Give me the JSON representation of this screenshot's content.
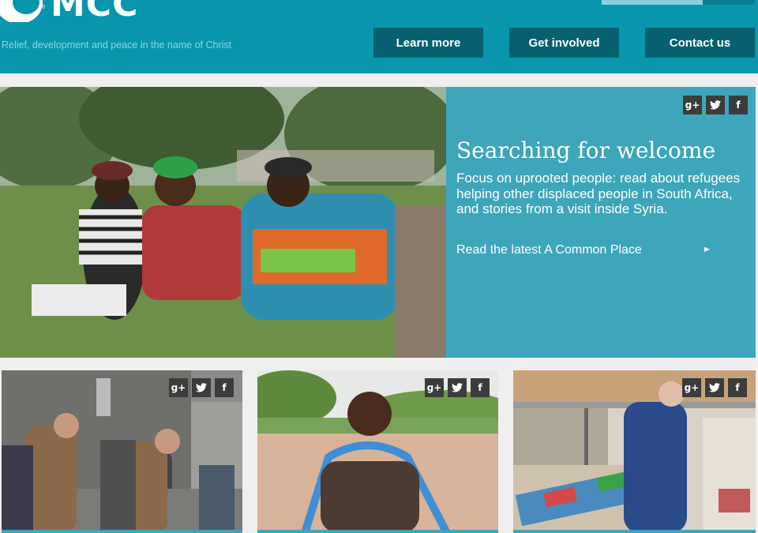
{
  "brand": {
    "logo_text": "MCC",
    "registered_mark": "®",
    "tagline": "Relief, development and peace in the name of Christ"
  },
  "nav": {
    "items": [
      {
        "label": "Learn more"
      },
      {
        "label": "Get involved"
      },
      {
        "label": "Contact us"
      }
    ]
  },
  "share": {
    "google_plus": "g+",
    "twitter": "t",
    "facebook": "f"
  },
  "hero": {
    "title": "Searching for welcome",
    "description": "Focus on uprooted people: read about refugees helping other displaced people in South Africa, and stories from a visit inside Syria.",
    "link_label": "Read the latest A Common Place",
    "link_arrow": "►"
  },
  "cards": [
    {
      "share": true
    },
    {
      "share": true
    },
    {
      "share": true
    }
  ],
  "colors": {
    "header": "#0996ac",
    "nav_button": "#07606f",
    "panel": "#3ea6bb",
    "share_button": "#3c3c3c"
  }
}
